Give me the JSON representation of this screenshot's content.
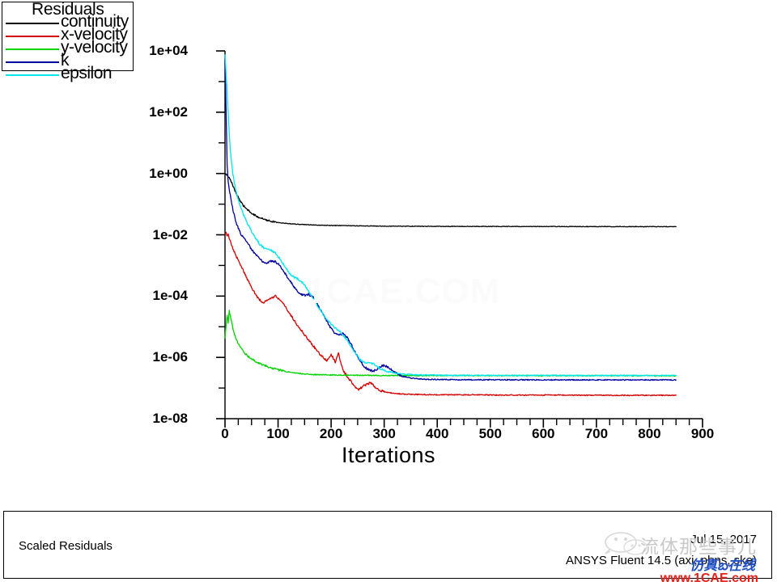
{
  "legend": {
    "title": "Residuals",
    "items": [
      {
        "label": "continuity",
        "color": "#000000"
      },
      {
        "label": "x-velocity",
        "color": "#d40000"
      },
      {
        "label": "y-velocity",
        "color": "#00d400"
      },
      {
        "label": "k",
        "color": "#0000a0"
      },
      {
        "label": "epsilon",
        "color": "#00e5ee"
      }
    ]
  },
  "footer": {
    "left_label": "Scaled Residuals",
    "date": "Jul 15, 2017",
    "version": "ANSYS Fluent 14.5 (axi, pbns, ske)"
  },
  "watermarks": {
    "plot": "1CAE.COM",
    "wechat_cn": "流体那些事儿",
    "blue_cn": "仿真బ在线",
    "red_url": "www.1CAE.com"
  },
  "chart_data": {
    "type": "line",
    "title": "Residuals",
    "xlabel": "Iterations",
    "ylabel": "",
    "yscale": "log",
    "grid": false,
    "legend_position": "top-left",
    "xlim": [
      0,
      900
    ],
    "ylim": [
      1e-08,
      10000
    ],
    "xticks": [
      0,
      100,
      200,
      300,
      400,
      500,
      600,
      700,
      800,
      900
    ],
    "yticks": [
      "1e-08",
      "1e-06",
      "1e-04",
      "1e-02",
      "1e+00",
      "1e+02",
      "1e+04"
    ],
    "x_minor_tick_step": 25,
    "series": [
      {
        "name": "continuity",
        "color": "#000000",
        "x": [
          0,
          3,
          6,
          10,
          14,
          18,
          22,
          26,
          30,
          36,
          42,
          50,
          60,
          70,
          80,
          95,
          110,
          130,
          150,
          180,
          210,
          250,
          300,
          360,
          420,
          500,
          580,
          660,
          740,
          800,
          850
        ],
        "y": [
          1.0,
          0.92,
          0.8,
          0.62,
          0.44,
          0.3,
          0.21,
          0.15,
          0.115,
          0.085,
          0.066,
          0.05,
          0.04,
          0.034,
          0.03,
          0.026,
          0.024,
          0.0225,
          0.0215,
          0.0205,
          0.02,
          0.0196,
          0.0192,
          0.019,
          0.0188,
          0.0187,
          0.0186,
          0.0186,
          0.0185,
          0.0185,
          0.0185
        ]
      },
      {
        "name": "x-velocity",
        "color": "#d40000",
        "x": [
          0,
          2,
          4,
          6,
          8,
          10,
          14,
          20,
          28,
          36,
          46,
          58,
          70,
          82,
          95,
          108,
          120,
          134,
          148,
          160,
          172,
          182,
          192,
          200,
          208,
          214,
          220,
          226,
          232,
          238,
          244,
          252,
          262,
          274,
          288,
          300,
          320,
          350,
          400,
          460,
          530,
          600,
          680,
          760,
          850
        ],
        "y": [
          0.01,
          0.0115,
          0.009,
          0.0105,
          0.0075,
          0.0062,
          0.004,
          0.0022,
          0.00115,
          0.0006,
          0.00026,
          0.00011,
          6e-05,
          7.5e-05,
          0.0001,
          6.5e-05,
          3e-05,
          1.3e-05,
          6e-06,
          3.2e-06,
          1.8e-06,
          1.1e-06,
          8e-07,
          1.3e-06,
          7e-07,
          1.4e-06,
          5e-07,
          3e-07,
          2.2e-07,
          1.6e-07,
          1.1e-07,
          9e-08,
          1.2e-07,
          1.5e-07,
          9e-08,
          7.5e-08,
          6.6e-08,
          6.2e-08,
          6e-08,
          6e-08,
          5.9e-08,
          5.9e-08,
          5.8e-08,
          5.8e-08,
          5.8e-08
        ]
      },
      {
        "name": "y-velocity",
        "color": "#00d400",
        "x": [
          0,
          2,
          4,
          6,
          8,
          10,
          12,
          15,
          18,
          22,
          28,
          34,
          42,
          52,
          64,
          78,
          94,
          110,
          130,
          150,
          170,
          190,
          210,
          230,
          250,
          280,
          320,
          380,
          450,
          530,
          620,
          710,
          790,
          850
        ],
        "y": [
          4e-06,
          1.1e-05,
          2.4e-05,
          1.4e-05,
          3.2e-05,
          2.2e-05,
          1.5e-05,
          9e-06,
          5.5e-06,
          3.6e-06,
          2.2e-06,
          1.6e-06,
          1.15e-06,
          8.5e-07,
          6.5e-07,
          5.2e-07,
          4.2e-07,
          3.6e-07,
          3.1e-07,
          2.9e-07,
          2.75e-07,
          2.7e-07,
          2.65e-07,
          2.62e-07,
          2.6e-07,
          2.58e-07,
          2.56e-07,
          2.55e-07,
          2.55e-07,
          2.54e-07,
          2.54e-07,
          2.54e-07,
          2.53e-07,
          2.53e-07
        ]
      },
      {
        "name": "k",
        "color": "#0000a0",
        "x": [
          0,
          2,
          4,
          6,
          8,
          12,
          16,
          22,
          30,
          40,
          52,
          62,
          72,
          80,
          88,
          96,
          104,
          112,
          120,
          130,
          140,
          150,
          158,
          166,
          174,
          182,
          190,
          198,
          206,
          214,
          222,
          230,
          238,
          246,
          254,
          262,
          270,
          278,
          286,
          294,
          300,
          310,
          320,
          335,
          355,
          380,
          420,
          470,
          530,
          600,
          680,
          760,
          850
        ],
        "y": [
          5000,
          120,
          2.0,
          0.55,
          0.3,
          0.12,
          0.055,
          0.022,
          0.0105,
          0.0062,
          0.003,
          0.0019,
          0.0013,
          0.0012,
          0.0014,
          0.0013,
          0.00095,
          0.0006,
          0.00036,
          0.0002,
          0.00012,
          0.000105,
          0.000115,
          9e-05,
          5.5e-05,
          3.2e-05,
          1.8e-05,
          1e-05,
          6.5e-06,
          5.5e-06,
          6e-06,
          4.5e-06,
          2.6e-06,
          1.4e-06,
          8e-07,
          5e-07,
          4e-07,
          3.6e-07,
          4e-07,
          5.2e-07,
          5.5e-07,
          4.5e-07,
          3.2e-07,
          2.4e-07,
          2.05e-07,
          1.92e-07,
          1.88e-07,
          1.86e-07,
          1.85e-07,
          1.85e-07,
          1.84e-07,
          1.84e-07,
          1.84e-07
        ]
      },
      {
        "name": "epsilon",
        "color": "#00e5ee",
        "x": [
          0,
          1,
          3,
          5,
          7,
          10,
          14,
          20,
          26,
          34,
          42,
          50,
          58,
          66,
          74,
          82,
          90,
          98,
          106,
          114,
          122,
          130,
          138,
          146,
          154,
          162,
          170,
          180,
          190,
          200,
          210,
          220,
          230,
          240,
          248,
          256,
          264,
          272,
          280,
          290,
          300,
          315,
          335,
          360,
          400,
          450,
          520,
          600,
          690,
          780,
          850
        ],
        "y": [
          8000,
          4000,
          900,
          200,
          45,
          6.0,
          1.2,
          0.3,
          0.115,
          0.05,
          0.025,
          0.013,
          0.0075,
          0.0048,
          0.0036,
          0.0034,
          0.003,
          0.0022,
          0.0014,
          0.00085,
          0.00055,
          0.00042,
          0.00036,
          0.00028,
          0.00018,
          0.00011,
          6.5e-05,
          3.4e-05,
          1.9e-05,
          1.2e-05,
          8.5e-06,
          6e-06,
          3.6e-06,
          2e-06,
          1.2e-06,
          8e-07,
          6.5e-07,
          6.8e-07,
          6e-07,
          4.6e-07,
          3.8e-07,
          3.2e-07,
          2.85e-07,
          2.7e-07,
          2.62e-07,
          2.6e-07,
          2.58e-07,
          2.58e-07,
          2.57e-07,
          2.57e-07,
          2.57e-07
        ]
      }
    ]
  }
}
